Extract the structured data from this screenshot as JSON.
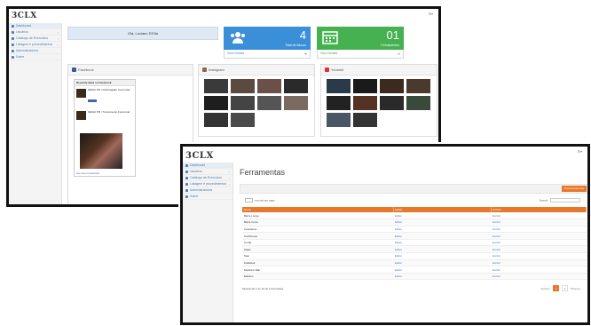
{
  "window1": {
    "logo": "3CLX",
    "user_greeting": "Olá, Luciano D'Ella",
    "sidebar": [
      {
        "label": "Dashboard",
        "active": true
      },
      {
        "label": "Usuários"
      },
      {
        "label": "Catálogo de Exercícios"
      },
      {
        "label": "Listagem e procedimentos"
      },
      {
        "label": "Administradores"
      },
      {
        "label": "Sobre"
      }
    ],
    "stats": [
      {
        "value": "4",
        "caption": "Total de Alunos",
        "link": "View Details",
        "icon": "users-icon",
        "color": "#3b8fd9"
      },
      {
        "value": "01",
        "caption": "Treinamentos",
        "link": "View Details",
        "icon": "calendar-icon",
        "color": "#46b151"
      }
    ],
    "panels": {
      "facebook": {
        "title": "Facebook",
        "box_title": "Recently liked on Facebook",
        "posts": [
          "SENAI PR / Participação Comercial",
          "SENAI PR / Treinamento Funcional"
        ],
        "footer": "See more on Facebook"
      },
      "instagram": {
        "title": "Instagram"
      },
      "youtube": {
        "title": "Youtube"
      }
    }
  },
  "window2": {
    "logo": "3CLX",
    "page_title": "Ferramentas",
    "new_button": "Nova ferramenta",
    "length_label": "records per page",
    "length_value": "10",
    "search_label": "Search:",
    "columns": [
      "Nome",
      "Editar",
      "Excluir"
    ],
    "rows": [
      [
        "Barra Longa",
        "Editar",
        "Excluir"
      ],
      [
        "Barra Curta",
        "Editar",
        "Excluir"
      ],
      [
        "Caneleiras",
        "Editar",
        "Excluir"
      ],
      [
        "Colchonete",
        "Editar",
        "Excluir"
      ],
      [
        "Corda",
        "Editar",
        "Excluir"
      ],
      [
        "Halter",
        "Editar",
        "Excluir"
      ],
      [
        "Step",
        "Editar",
        "Excluir"
      ],
      [
        "Kettlebell",
        "Editar",
        "Excluir"
      ],
      [
        "Medicine Ball",
        "Editar",
        "Excluir"
      ],
      [
        "Elástico",
        "Editar",
        "Excluir"
      ]
    ],
    "info": "Mostrando 1 de 10 de 13 Entradas",
    "pagination": {
      "prev": "Anterior",
      "pages": [
        "1",
        "2"
      ],
      "current": "1",
      "next": "Próximo"
    }
  }
}
